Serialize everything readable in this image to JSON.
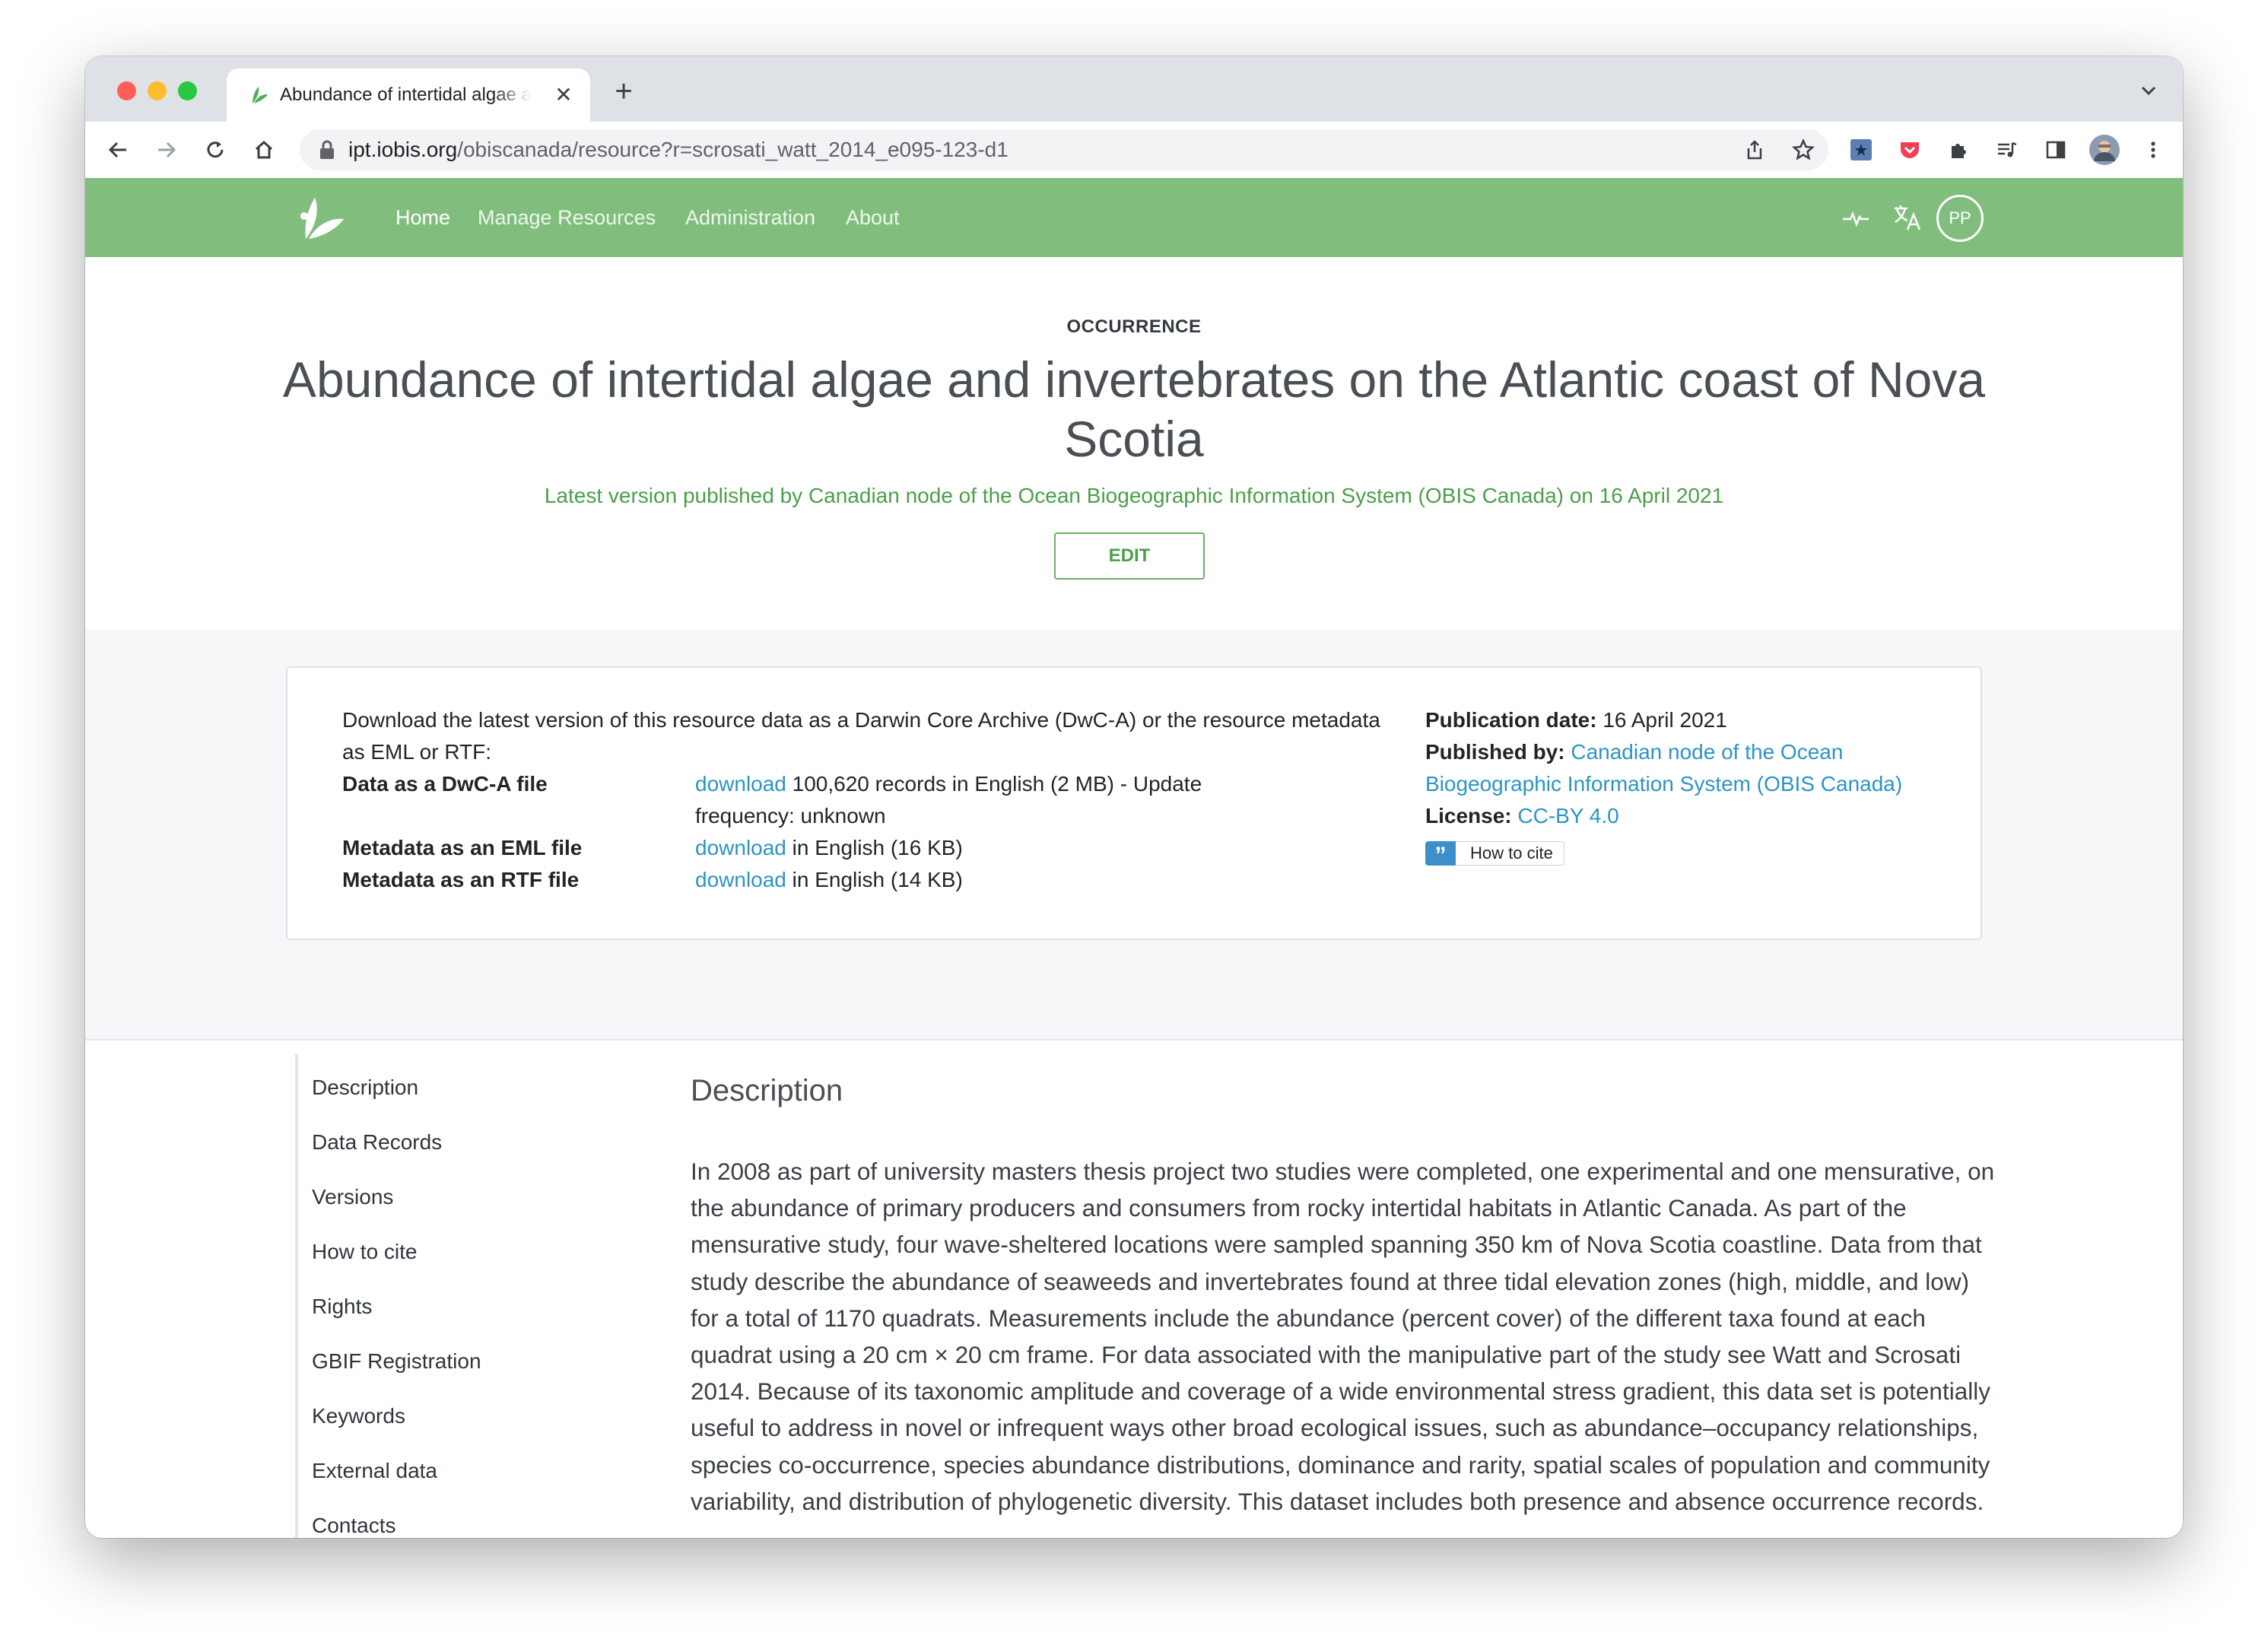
{
  "browser": {
    "tab_title": "Abundance of intertidal algae and invertebrates on the Atlantic coast of Nova Scotia",
    "url_host": "ipt.iobis.org",
    "url_path": "/obiscanada/resource?r=scrosati_watt_2014_e095-123-d1"
  },
  "nav": {
    "items": [
      "Home",
      "Manage Resources",
      "Administration",
      "About"
    ],
    "active": "Home",
    "avatar_initials": "PP"
  },
  "hero": {
    "eyebrow": "OCCURRENCE",
    "title": "Abundance of intertidal algae and invertebrates on the Atlantic coast of Nova Scotia",
    "published_line": "Latest version published by Canadian node of the Ocean Biogeographic Information System (OBIS Canada) on 16 April 2021",
    "edit_label": "EDIT"
  },
  "download": {
    "intro": "Download the latest version of this resource data as a Darwin Core Archive (DwC-A) or the resource metadata as EML or RTF:",
    "rows": [
      {
        "label": "Data as a DwC-A file",
        "link": "download",
        "text": " 100,620 records in English (2 MB) - Update frequency: unknown"
      },
      {
        "label": "Metadata as an EML file",
        "link": "download",
        "text": " in English (16 KB)"
      },
      {
        "label": "Metadata as an RTF file",
        "link": "download",
        "text": " in English (14 KB)"
      }
    ],
    "publication_date_label": "Publication date:",
    "publication_date": "16 April 2021",
    "published_by_label": "Published by:",
    "published_by": "Canadian node of the Ocean Biogeographic Information System (OBIS Canada)",
    "license_label": "License:",
    "license": "CC-BY 4.0",
    "cite_label": "How to cite"
  },
  "sidebar": {
    "items": [
      "Description",
      "Data Records",
      "Versions",
      "How to cite",
      "Rights",
      "GBIF Registration",
      "Keywords",
      "External data",
      "Contacts"
    ]
  },
  "main": {
    "section_title": "Description",
    "description": "In 2008 as part of university masters thesis project two studies were completed, one experimental and one mensurative, on the abundance of primary producers and consumers from rocky intertidal habitats in Atlantic Canada. As part of the mensurative study, four wave-sheltered locations were sampled spanning 350 km of Nova Scotia coastline. Data from that study describe the abundance of seaweeds and invertebrates found at three tidal elevation zones (high, middle, and low) for a total of 1170 quadrats. Measurements include the abundance (percent cover) of the different taxa found at each quadrat using a 20 cm × 20 cm frame. For data associated with the manipulative part of the study see Watt and Scrosati 2014. Because of its taxonomic amplitude and coverage of a wide environmental stress gradient, this data set is potentially useful to address in novel or infrequent ways other broad ecological issues, such as abundance–occupancy relationships, species co-occurrence, species abundance distributions, dominance and rarity, spatial scales of population and community variability, and distribution of phylogenetic diversity. This dataset includes both presence and absence occurrence records."
  },
  "colors": {
    "header_green": "#81be7e",
    "accent_green": "#4aa04a",
    "link_blue": "#2d94c4"
  }
}
